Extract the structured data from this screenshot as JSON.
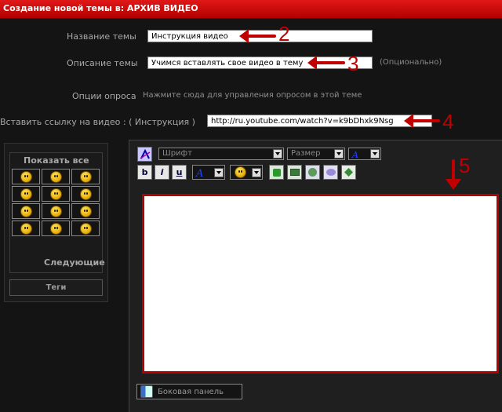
{
  "header": {
    "title": "Создание новой темы в: АРХИВ ВИДЕО"
  },
  "form": {
    "topic_name": {
      "label": "Название темы",
      "value": "Инструкция видео"
    },
    "topic_desc": {
      "label": "Описание темы",
      "value": "Учимся вставлять свое видео в тему",
      "note": "(Опционально)"
    },
    "poll": {
      "label": "Опции опроса",
      "link": "Нажмите сюда для управления опросом в этой теме"
    },
    "video": {
      "label": "Вставить ссылку на видео : ( Инструкция )",
      "value": "http://ru.youtube.com/watch?v=k9bDhxk9Nsg"
    }
  },
  "annotations": [
    "2",
    "3",
    "4",
    "5"
  ],
  "smilies": {
    "show_all": "Показать все",
    "next": "Следующие",
    "tags_button": "Теги",
    "count": 12
  },
  "editor": {
    "font_select": "Шрифт",
    "size_select": "Размер",
    "bold": "b",
    "italic": "i",
    "underline": "u",
    "side_panel": "Боковая панель"
  },
  "colors": {
    "accent": "#c00000",
    "header_bg": "#d00000",
    "bg": "#141414"
  }
}
